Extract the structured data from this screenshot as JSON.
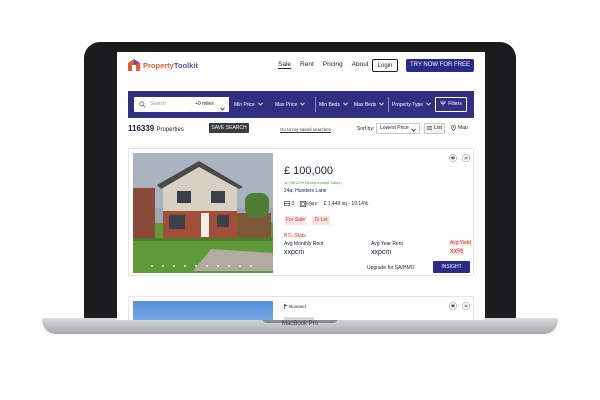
{
  "brand": {
    "name_part1": "Property",
    "name_part2": "Toolkit",
    "accent": "#2b2a86",
    "logo_orange": "#e25d33",
    "logo_purple": "#6b4ea8"
  },
  "nav": {
    "links": [
      "Sale",
      "Rent",
      "Pricing",
      "About"
    ],
    "active": "Sale",
    "login_label": "Login",
    "cta_label": "TRY NOW FOR FREE"
  },
  "search": {
    "placeholder": "Search",
    "radius": "+0 miles",
    "min_price": "Min Price",
    "max_price": "Max Price",
    "min_beds": "Min Beds",
    "max_beds": "Max Beds",
    "property_type": "Property Type",
    "filters_label": "Filters",
    "bar_color": "#322f82"
  },
  "results": {
    "count": "116339",
    "count_label": "Properties",
    "save_search_label": "SAVE SEARCH",
    "saved_link": "Go to my saved searches",
    "sort_label": "Sort by:",
    "sort_value": "Lowest Price",
    "list_label": "List",
    "map_label": "Map"
  },
  "listing": {
    "price": "£ 100,000",
    "below_market": "(56.22% Below market Value)",
    "address": "24a, Hunders Lane",
    "beds": "3",
    "area": "69m²",
    "price_per_sq": "£ 1,449 sq - 19.14%",
    "tags": [
      "For Sale",
      "To Let"
    ],
    "btl_title": "BTL Stats",
    "avg_monthly_rent_label": "Avg Monthly Rent",
    "avg_monthly_rent_value": "xxpcm",
    "avg_year_rent_label": "Avg Year Rent",
    "avg_year_rent_value": "xxpcm",
    "avg_yield_label": "Avg Yield",
    "avg_yield_value": "xx%",
    "upgrade_label": "Upgrade for SA/HMO",
    "insight_label": "INSIGHT",
    "photo_count": 10
  },
  "listing2": {
    "boosted_label": "Boosted"
  },
  "device": {
    "label": "MacBook Pro"
  }
}
